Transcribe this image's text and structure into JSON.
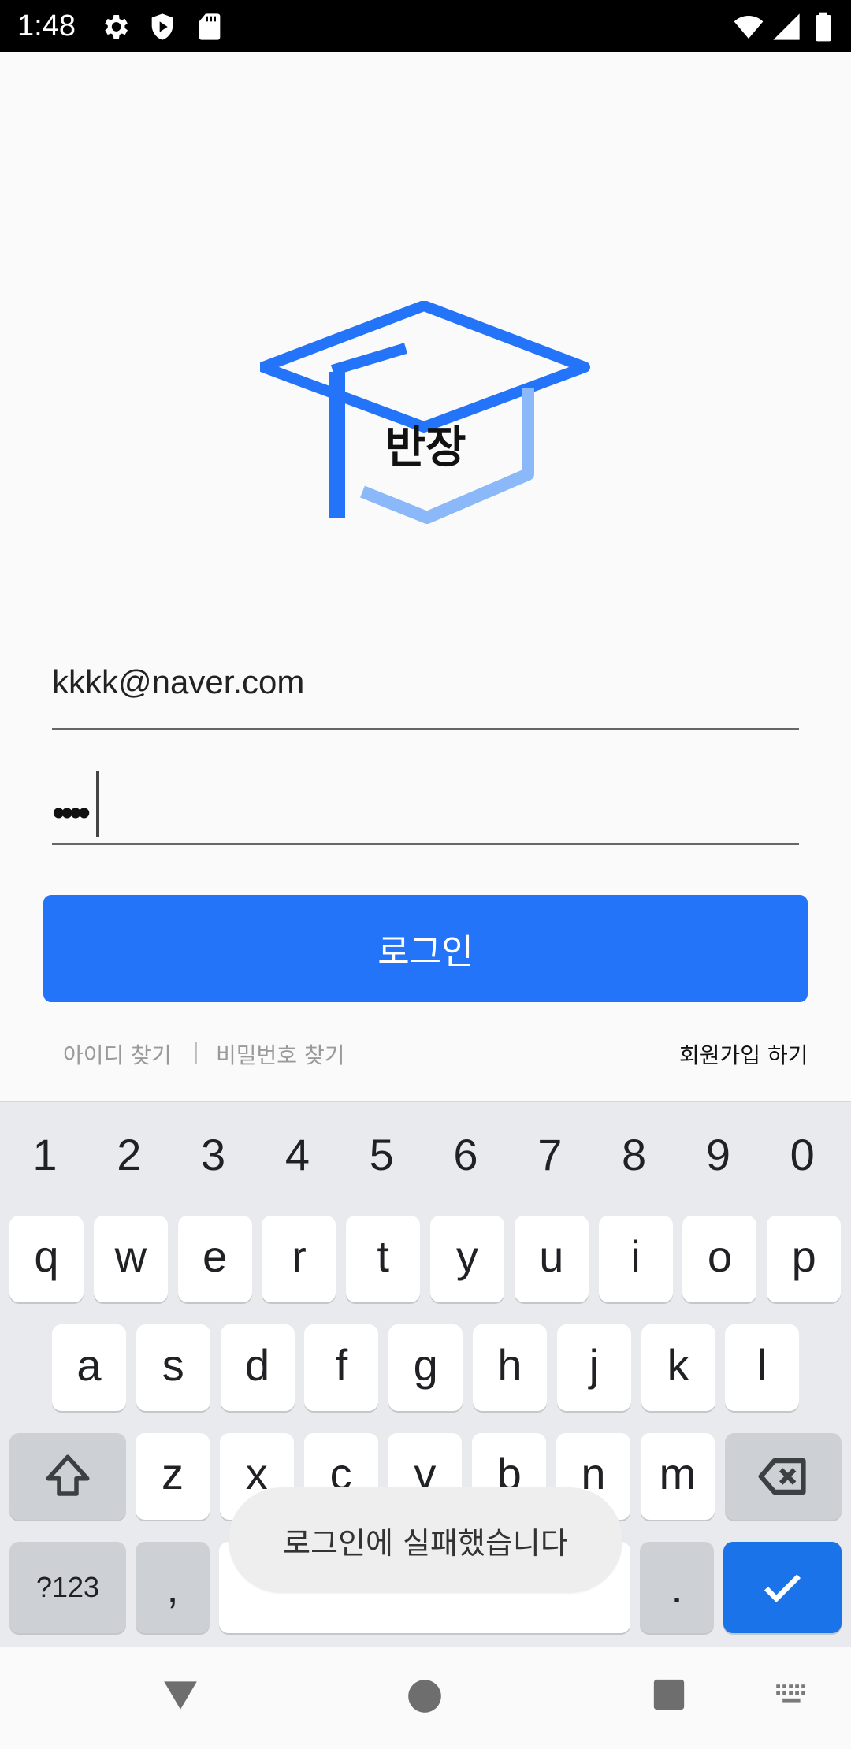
{
  "status_bar": {
    "time": "1:48",
    "icons": [
      "settings-icon",
      "shield-play-icon",
      "sd-card-icon",
      "wifi-icon",
      "signal-icon",
      "battery-icon"
    ]
  },
  "logo": {
    "text": "반장",
    "colors": {
      "primary": "#2374f8",
      "light": "#8ab8f8"
    }
  },
  "form": {
    "email_value": "kkkk@naver.com",
    "password_mask": "••••"
  },
  "login_button": {
    "label": "로그인"
  },
  "links": {
    "find_id": "아이디 찾기",
    "separator": "|",
    "find_password": "비밀번호 찾기",
    "signup": "회원가입 하기"
  },
  "keyboard": {
    "numbers": [
      "1",
      "2",
      "3",
      "4",
      "5",
      "6",
      "7",
      "8",
      "9",
      "0"
    ],
    "row1": [
      "q",
      "w",
      "e",
      "r",
      "t",
      "y",
      "u",
      "i",
      "o",
      "p"
    ],
    "row2": [
      "a",
      "s",
      "d",
      "f",
      "g",
      "h",
      "j",
      "k",
      "l"
    ],
    "row3": [
      "z",
      "x",
      "c",
      "v",
      "b",
      "n",
      "m"
    ],
    "symbols_label": "?123",
    "comma": ",",
    "period": "."
  },
  "toast": {
    "message": "로그인에 실패했습니다"
  },
  "colors": {
    "accent": "#2374f8",
    "enter_key": "#1a73e8"
  }
}
